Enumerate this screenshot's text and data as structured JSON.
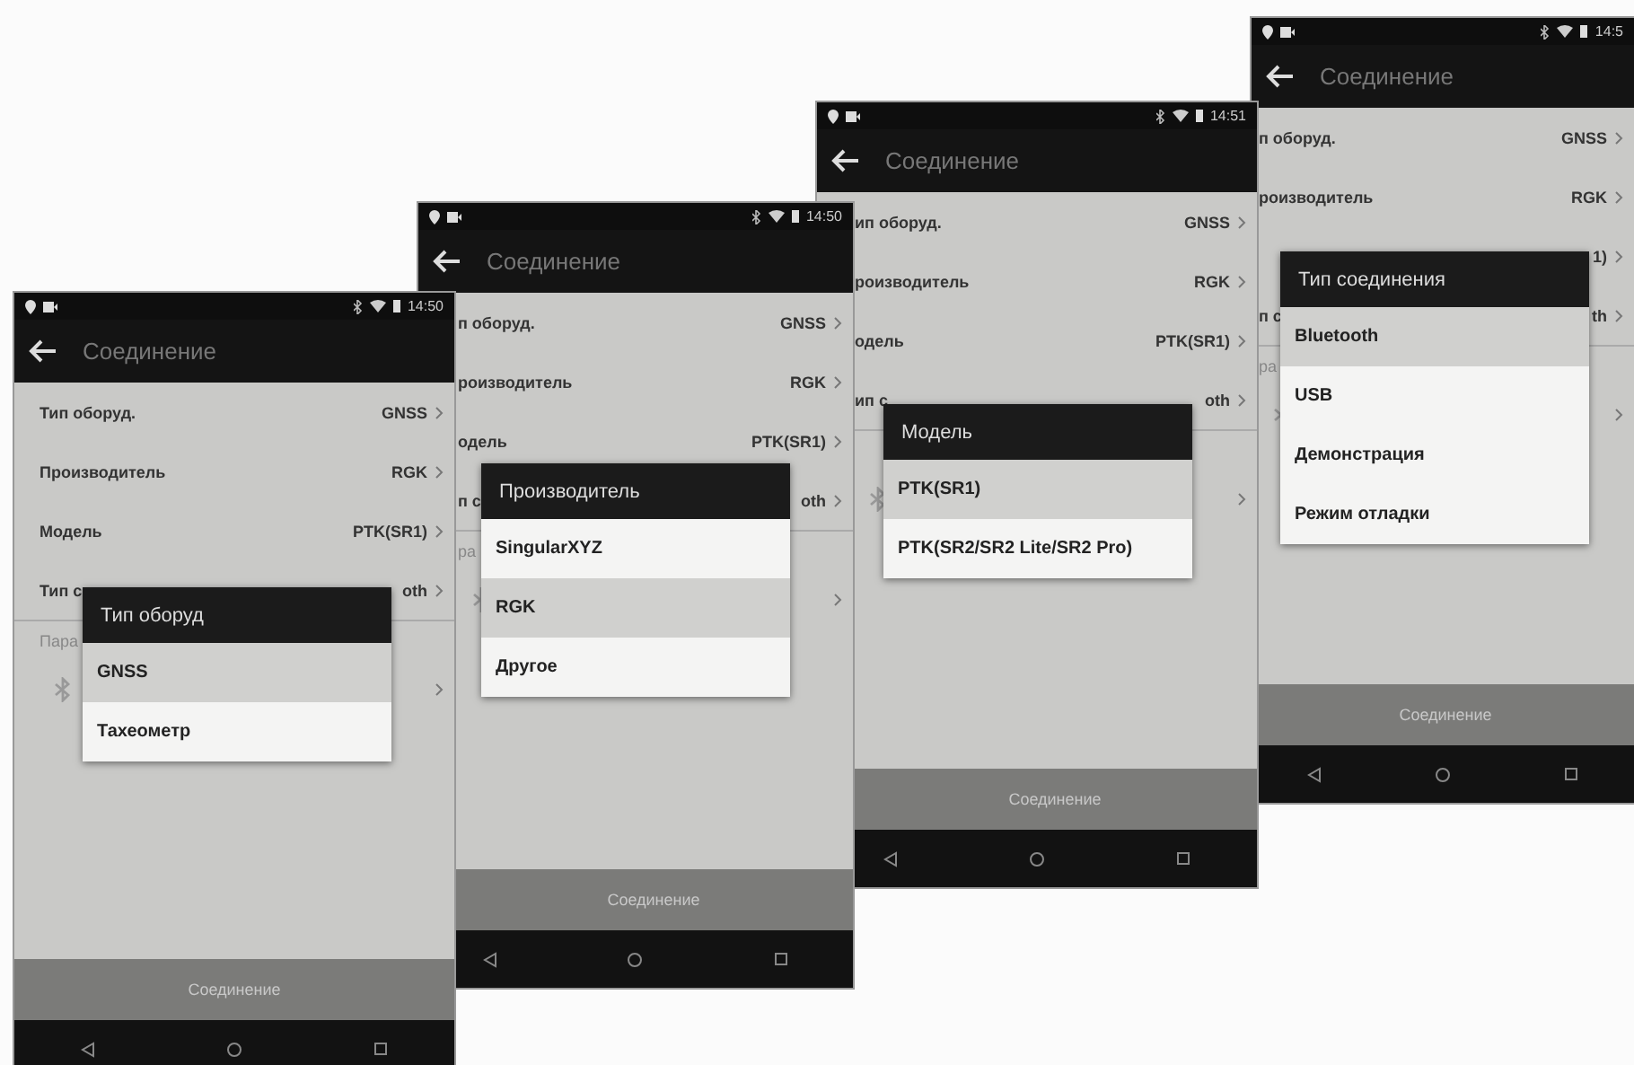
{
  "phones": [
    {
      "status_time": "14:50",
      "title": "Соединение",
      "rows": [
        {
          "label": "Тип оборуд.",
          "value": "GNSS"
        },
        {
          "label": "Производитель",
          "value": "RGK"
        },
        {
          "label": "Модель",
          "value": "PTK(SR1)"
        },
        {
          "label": "Тип с",
          "value": "oth"
        }
      ],
      "section": "Пара",
      "connect_button": "Соединение",
      "dialog": {
        "title": "Тип оборуд",
        "options": [
          {
            "label": "GNSS",
            "selected": true
          },
          {
            "label": "Тахеометр",
            "selected": false
          }
        ]
      }
    },
    {
      "status_time": "14:50",
      "title": "Соединение",
      "rows": [
        {
          "label": "п оборуд.",
          "value": "GNSS"
        },
        {
          "label": "роизводитель",
          "value": "RGK"
        },
        {
          "label": "одель",
          "value": "PTK(SR1)"
        },
        {
          "label": "п с",
          "value": "oth"
        }
      ],
      "section": "ра",
      "connect_button": "Соединение",
      "dialog": {
        "title": "Производитель",
        "options": [
          {
            "label": "SingularXYZ",
            "selected": false
          },
          {
            "label": "RGK",
            "selected": true
          },
          {
            "label": "Другое",
            "selected": false
          }
        ]
      }
    },
    {
      "status_time": "14:51",
      "title": "Соединение",
      "rows": [
        {
          "label": "ип оборуд.",
          "value": "GNSS"
        },
        {
          "label": "роизводитель",
          "value": "RGK"
        },
        {
          "label": "одель",
          "value": "PTK(SR1)"
        },
        {
          "label": "ип с",
          "value": "oth"
        }
      ],
      "connect_button": "Соединение",
      "dialog": {
        "title": "Модель",
        "options": [
          {
            "label": "PTK(SR1)",
            "selected": true
          },
          {
            "label": "PTK(SR2/SR2 Lite/SR2 Pro)",
            "selected": false
          }
        ]
      }
    },
    {
      "status_time": "14:5",
      "title": "Соединение",
      "rows": [
        {
          "label": "п оборуд.",
          "value": "GNSS"
        },
        {
          "label": "роизводитель",
          "value": "RGK"
        },
        {
          "value": "1)"
        },
        {
          "label": "п с",
          "value": "th"
        }
      ],
      "section": "ра",
      "connect_button": "Соединение",
      "dialog": {
        "title": "Тип соединения",
        "options": [
          {
            "label": "Bluetooth",
            "selected": true
          },
          {
            "label": "USB",
            "selected": false
          },
          {
            "label": "Демонстрация",
            "selected": false
          },
          {
            "label": "Режим отладки",
            "selected": false
          }
        ]
      }
    }
  ]
}
